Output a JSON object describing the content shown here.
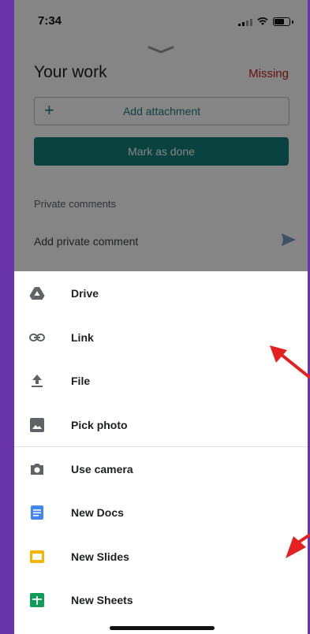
{
  "status_bar": {
    "time": "7:34"
  },
  "assignment": {
    "title": "Your work",
    "status": "Missing",
    "add_attachment": "Add attachment",
    "mark_done": "Mark as done",
    "private_comments_title": "Private comments",
    "comment_placeholder": "Add private comment"
  },
  "sheet": {
    "items": [
      {
        "label": "Drive",
        "icon": "drive-icon"
      },
      {
        "label": "Link",
        "icon": "link-icon"
      },
      {
        "label": "File",
        "icon": "upload-icon"
      },
      {
        "label": "Pick photo",
        "icon": "image-icon"
      },
      {
        "label": "Use camera",
        "icon": "camera-icon"
      },
      {
        "label": "New Docs",
        "icon": "docs-icon"
      },
      {
        "label": "New Slides",
        "icon": "slides-icon"
      },
      {
        "label": "New Sheets",
        "icon": "sheets-icon"
      }
    ]
  },
  "colors": {
    "accent": "#137f7a",
    "missing": "#c5221f",
    "docs": "#4285f4",
    "slides": "#f4b400",
    "sheets": "#0f9d58",
    "annotation_arrow": "#e52020",
    "frame": "#6a35a8"
  }
}
